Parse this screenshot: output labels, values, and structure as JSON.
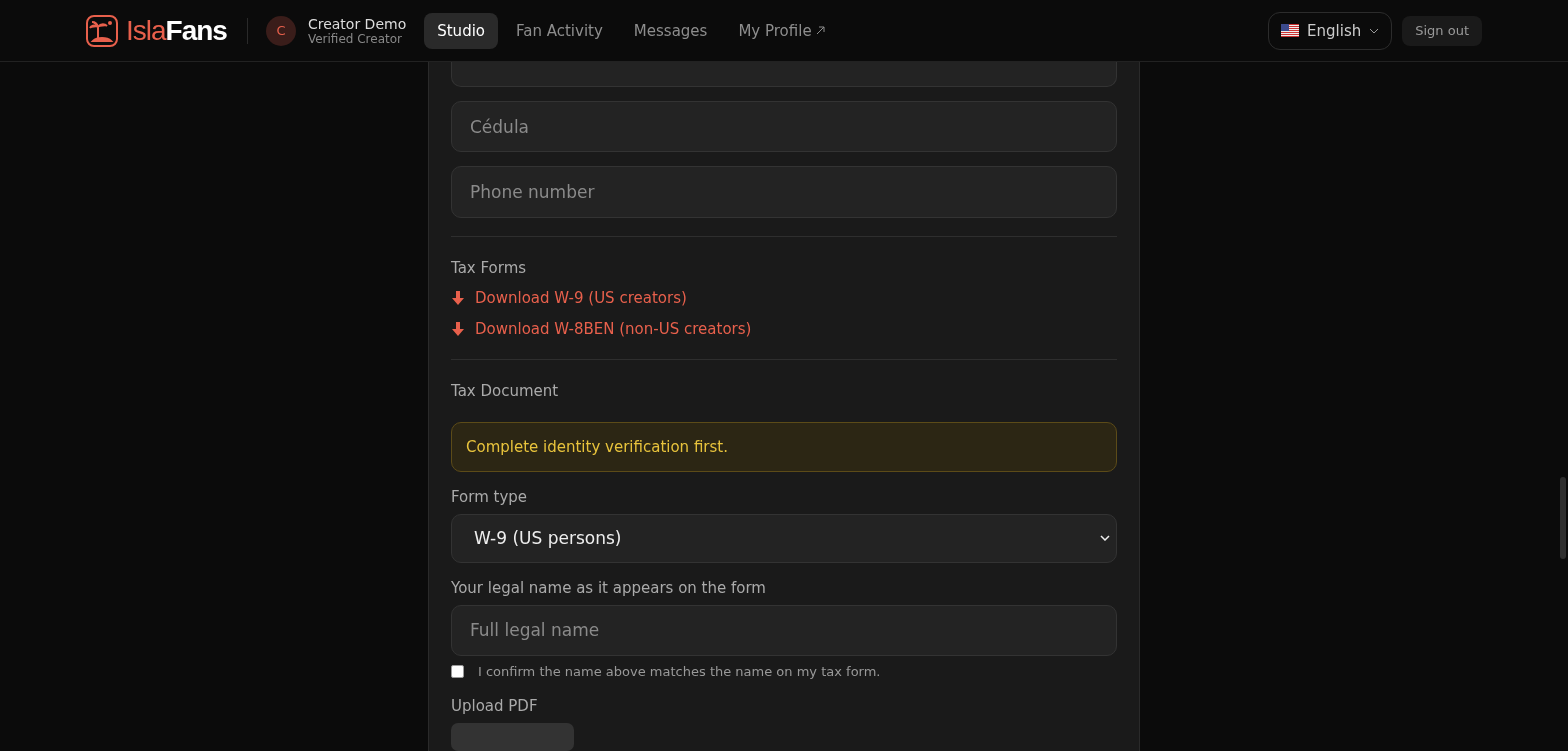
{
  "header": {
    "brand": {
      "part_1": "Isla",
      "part_2": "Fans"
    },
    "user": {
      "initial": "C",
      "name": "Creator Demo",
      "role": "Verified Creator"
    },
    "nav": [
      {
        "label": "Studio",
        "selected": true,
        "external": false
      },
      {
        "label": "Fan Activity",
        "selected": false,
        "external": false
      },
      {
        "label": "Messages",
        "selected": false,
        "external": false
      },
      {
        "label": "My Profile",
        "selected": false,
        "external": true
      }
    ],
    "language": "English",
    "sign_out": "Sign out"
  },
  "fields": [
    {
      "placeholder": "Cédula"
    },
    {
      "placeholder": "Phone number"
    }
  ],
  "tax_forms": {
    "title": "Tax Forms",
    "links": [
      "Download W-9 (US creators)",
      "Download W-8BEN (non-US creators)"
    ]
  },
  "tax_document": {
    "title": "Tax Document",
    "alert": "Complete identity verification first.",
    "form_type_label": "Form type",
    "form_type_value": "W-9 (US persons)",
    "legal_name_label": "Your legal name as it appears on the form",
    "legal_name_placeholder": "Full legal name",
    "confirm": {
      "label": "I confirm the name above matches the name on my tax form.",
      "checked": false
    },
    "upload_label": "Upload PDF"
  }
}
